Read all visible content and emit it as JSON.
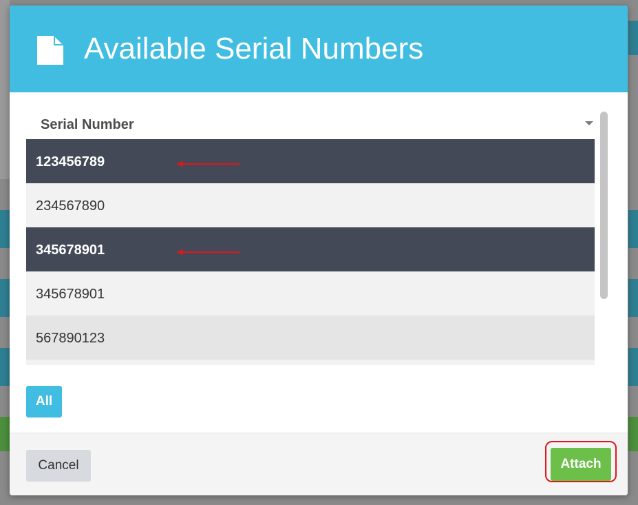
{
  "modal": {
    "title": "Available Serial Numbers",
    "icon": "document-icon"
  },
  "table": {
    "column_header": "Serial Number",
    "rows": [
      {
        "serial": "123456789",
        "selected": true
      },
      {
        "serial": "234567890",
        "selected": false
      },
      {
        "serial": "345678901",
        "selected": true
      },
      {
        "serial": "345678901",
        "selected": false
      },
      {
        "serial": "567890123",
        "selected": false
      }
    ]
  },
  "buttons": {
    "all_label": "All",
    "cancel_label": "Cancel",
    "attach_label": "Attach"
  },
  "colors": {
    "header": "#41bde2",
    "selected_row": "#434956",
    "attach": "#6cc04a",
    "annotation": "#e0161b"
  }
}
